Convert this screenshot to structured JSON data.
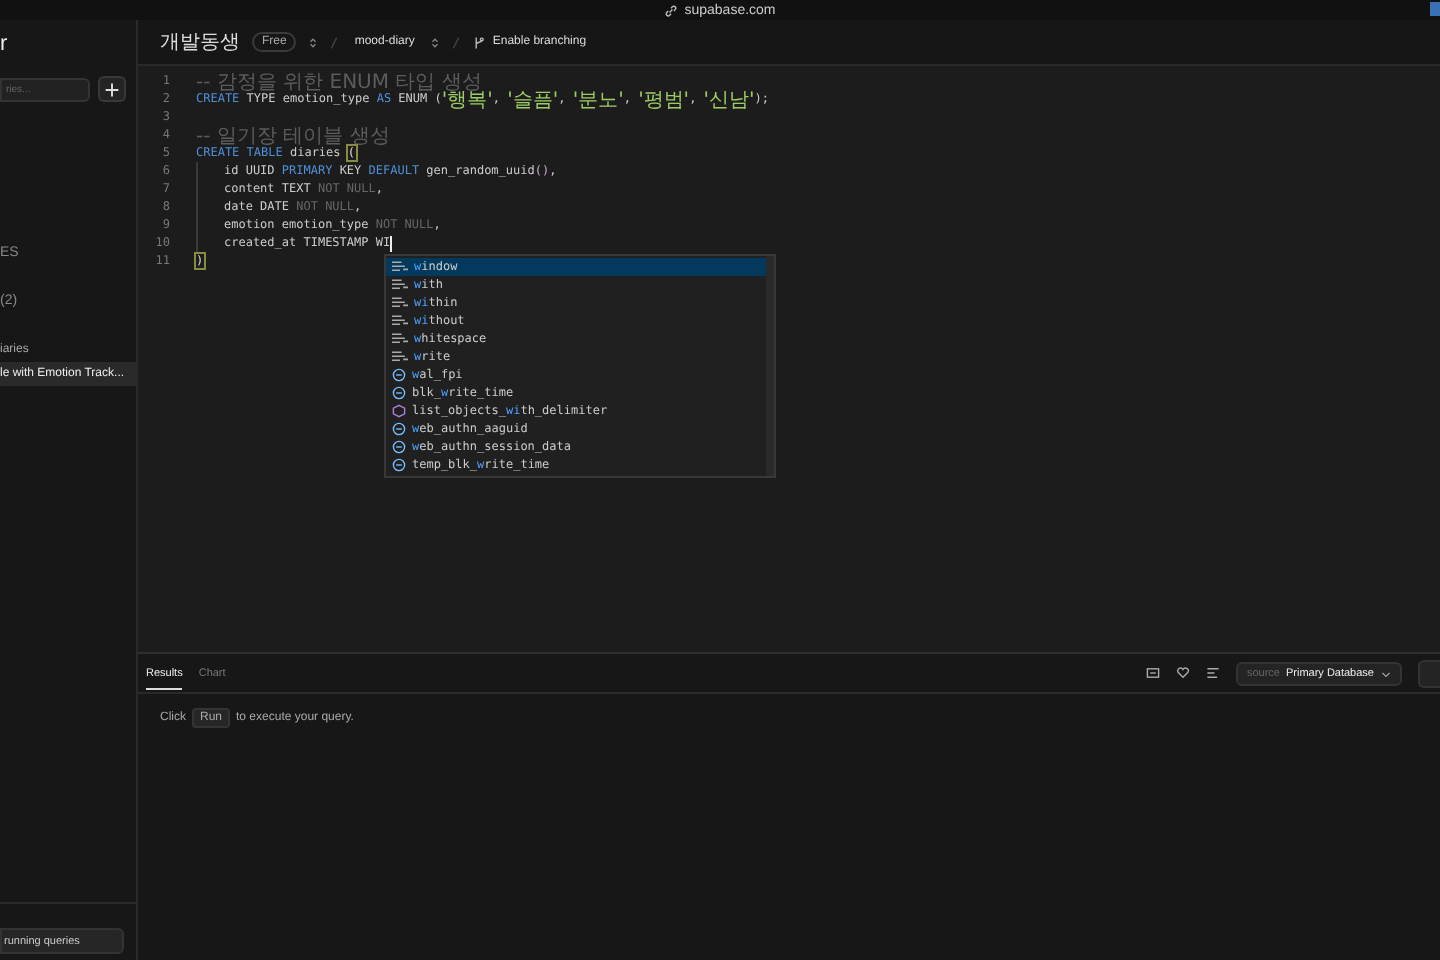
{
  "browser": {
    "url": "supabase.com"
  },
  "sidebar": {
    "title": "r",
    "search": {
      "placeholder": "ries..."
    },
    "items": [
      {
        "label": "ES",
        "kind": "heading",
        "selected": false
      },
      {
        "label": "(2)",
        "kind": "heading",
        "selected": false
      },
      {
        "label": "iaries",
        "kind": "folder",
        "selected": false
      },
      {
        "label": "le with Emotion Track...",
        "kind": "query",
        "selected": true
      }
    ],
    "footer_button": "running queries"
  },
  "header": {
    "org": "개발동생",
    "plan": "Free",
    "project": "mood-diary",
    "branching": "Enable branching"
  },
  "editor": {
    "lines": [
      {
        "number": "1",
        "tokens": [
          {
            "kind": "comment",
            "text": "-- 감정을 위한 ENUM 타입 생성"
          }
        ]
      },
      {
        "number": "2",
        "tokens": [
          {
            "kind": "keyword",
            "text": "CREATE"
          },
          {
            "kind": "plain",
            "text": " TYPE emotion_type "
          },
          {
            "kind": "keyword",
            "text": "AS"
          },
          {
            "kind": "plain",
            "text": " ENUM ("
          },
          {
            "kind": "string",
            "text": "'행복'"
          },
          {
            "kind": "plain",
            "text": ", "
          },
          {
            "kind": "string",
            "text": "'슬픔'"
          },
          {
            "kind": "plain",
            "text": ", "
          },
          {
            "kind": "string",
            "text": "'분노'"
          },
          {
            "kind": "plain",
            "text": ", "
          },
          {
            "kind": "string",
            "text": "'평범'"
          },
          {
            "kind": "plain",
            "text": ", "
          },
          {
            "kind": "string",
            "text": "'신남'"
          },
          {
            "kind": "plain",
            "text": ");"
          }
        ]
      },
      {
        "number": "3"
      },
      {
        "number": "4",
        "tokens": [
          {
            "kind": "comment",
            "text": "-- 일기장 테이블 생성"
          }
        ]
      },
      {
        "number": "5",
        "tokens": [
          {
            "kind": "keyword",
            "text": "CREATE"
          },
          {
            "kind": "keyword",
            "text": " TABLE"
          },
          {
            "kind": "plain",
            "text": " diaries "
          },
          {
            "kind": "bracket",
            "text": "("
          }
        ]
      },
      {
        "number": "6",
        "indented": true,
        "tokens": [
          {
            "kind": "plain",
            "text": "id UUID "
          },
          {
            "kind": "keyword",
            "text": "PRIMARY"
          },
          {
            "kind": "plain",
            "text": " KEY "
          },
          {
            "kind": "keyword",
            "text": "DEFAULT"
          },
          {
            "kind": "plain",
            "text": " gen_random_uuid"
          },
          {
            "kind": "paren",
            "text": "()"
          },
          {
            "kind": "plain",
            "text": ","
          }
        ]
      },
      {
        "number": "7",
        "indented": true,
        "tokens": [
          {
            "kind": "plain",
            "text": "content TEXT "
          },
          {
            "kind": "muted",
            "text": "NOT NULL"
          },
          {
            "kind": "plain",
            "text": ","
          }
        ]
      },
      {
        "number": "8",
        "indented": true,
        "tokens": [
          {
            "kind": "plain",
            "text": "date DATE "
          },
          {
            "kind": "muted",
            "text": "NOT NULL"
          },
          {
            "kind": "plain",
            "text": ","
          }
        ]
      },
      {
        "number": "9",
        "indented": true,
        "tokens": [
          {
            "kind": "plain",
            "text": "emotion emotion_type "
          },
          {
            "kind": "muted",
            "text": "NOT NULL"
          },
          {
            "kind": "plain",
            "text": ","
          }
        ]
      },
      {
        "number": "10",
        "indented": true,
        "tokens": [
          {
            "kind": "plain",
            "text": "created_at TIMESTAMP WI"
          }
        ],
        "cursor": true
      },
      {
        "number": "11",
        "tokens": [
          {
            "kind": "bracket",
            "text": ")"
          }
        ]
      }
    ],
    "suggestions": [
      {
        "label": "**w**indow",
        "kind": "keyword",
        "selected": true
      },
      {
        "label": "**w**ith",
        "kind": "keyword",
        "selected": false
      },
      {
        "label": "**wi**thin",
        "kind": "keyword",
        "selected": false
      },
      {
        "label": "**wi**thout",
        "kind": "keyword",
        "selected": false
      },
      {
        "label": "**w**hitespace",
        "kind": "keyword",
        "selected": false
      },
      {
        "label": "**w**rite",
        "kind": "keyword",
        "selected": false
      },
      {
        "label": "**w**al_fpi",
        "kind": "function",
        "selected": false
      },
      {
        "label": "blk_**w**rite_time",
        "kind": "function",
        "selected": false
      },
      {
        "label": "list_objects_**wi**th_delimiter",
        "kind": "method",
        "selected": false
      },
      {
        "label": "**w**eb_authn_aaguid",
        "kind": "function",
        "selected": false
      },
      {
        "label": "**w**eb_authn_session_data",
        "kind": "function",
        "selected": false
      },
      {
        "label": "temp_blk_**w**rite_time",
        "kind": "function",
        "selected": false
      }
    ]
  },
  "results": {
    "tabs": [
      {
        "label": "Results",
        "selected": true
      },
      {
        "label": "Chart",
        "selected": false
      }
    ],
    "source_label": "source",
    "database": "Primary Database",
    "message_before": "Click",
    "run_key": "Run",
    "message_after": "to execute your query."
  }
}
